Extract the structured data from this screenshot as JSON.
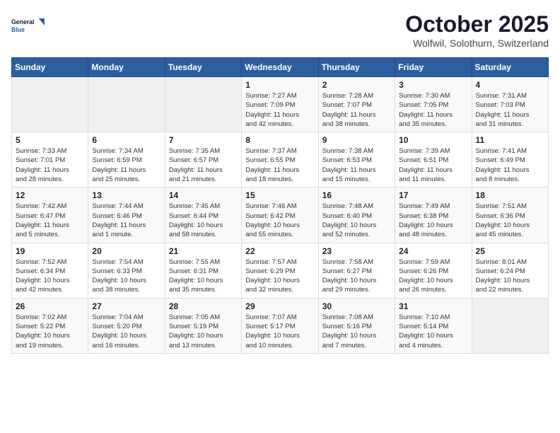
{
  "header": {
    "logo_line1": "General",
    "logo_line2": "Blue",
    "month_title": "October 2025",
    "location": "Wolfwil, Solothurn, Switzerland"
  },
  "weekdays": [
    "Sunday",
    "Monday",
    "Tuesday",
    "Wednesday",
    "Thursday",
    "Friday",
    "Saturday"
  ],
  "weeks": [
    [
      {
        "day": "",
        "info": ""
      },
      {
        "day": "",
        "info": ""
      },
      {
        "day": "",
        "info": ""
      },
      {
        "day": "1",
        "info": "Sunrise: 7:27 AM\nSunset: 7:09 PM\nDaylight: 11 hours\nand 42 minutes."
      },
      {
        "day": "2",
        "info": "Sunrise: 7:28 AM\nSunset: 7:07 PM\nDaylight: 11 hours\nand 38 minutes."
      },
      {
        "day": "3",
        "info": "Sunrise: 7:30 AM\nSunset: 7:05 PM\nDaylight: 11 hours\nand 35 minutes."
      },
      {
        "day": "4",
        "info": "Sunrise: 7:31 AM\nSunset: 7:03 PM\nDaylight: 11 hours\nand 31 minutes."
      }
    ],
    [
      {
        "day": "5",
        "info": "Sunrise: 7:33 AM\nSunset: 7:01 PM\nDaylight: 11 hours\nand 28 minutes."
      },
      {
        "day": "6",
        "info": "Sunrise: 7:34 AM\nSunset: 6:59 PM\nDaylight: 11 hours\nand 25 minutes."
      },
      {
        "day": "7",
        "info": "Sunrise: 7:35 AM\nSunset: 6:57 PM\nDaylight: 11 hours\nand 21 minutes."
      },
      {
        "day": "8",
        "info": "Sunrise: 7:37 AM\nSunset: 6:55 PM\nDaylight: 11 hours\nand 18 minutes."
      },
      {
        "day": "9",
        "info": "Sunrise: 7:38 AM\nSunset: 6:53 PM\nDaylight: 11 hours\nand 15 minutes."
      },
      {
        "day": "10",
        "info": "Sunrise: 7:39 AM\nSunset: 6:51 PM\nDaylight: 11 hours\nand 11 minutes."
      },
      {
        "day": "11",
        "info": "Sunrise: 7:41 AM\nSunset: 6:49 PM\nDaylight: 11 hours\nand 8 minutes."
      }
    ],
    [
      {
        "day": "12",
        "info": "Sunrise: 7:42 AM\nSunset: 6:47 PM\nDaylight: 11 hours\nand 5 minutes."
      },
      {
        "day": "13",
        "info": "Sunrise: 7:44 AM\nSunset: 6:46 PM\nDaylight: 11 hours\nand 1 minute."
      },
      {
        "day": "14",
        "info": "Sunrise: 7:45 AM\nSunset: 6:44 PM\nDaylight: 10 hours\nand 58 minutes."
      },
      {
        "day": "15",
        "info": "Sunrise: 7:46 AM\nSunset: 6:42 PM\nDaylight: 10 hours\nand 55 minutes."
      },
      {
        "day": "16",
        "info": "Sunrise: 7:48 AM\nSunset: 6:40 PM\nDaylight: 10 hours\nand 52 minutes."
      },
      {
        "day": "17",
        "info": "Sunrise: 7:49 AM\nSunset: 6:38 PM\nDaylight: 10 hours\nand 48 minutes."
      },
      {
        "day": "18",
        "info": "Sunrise: 7:51 AM\nSunset: 6:36 PM\nDaylight: 10 hours\nand 45 minutes."
      }
    ],
    [
      {
        "day": "19",
        "info": "Sunrise: 7:52 AM\nSunset: 6:34 PM\nDaylight: 10 hours\nand 42 minutes."
      },
      {
        "day": "20",
        "info": "Sunrise: 7:54 AM\nSunset: 6:33 PM\nDaylight: 10 hours\nand 38 minutes."
      },
      {
        "day": "21",
        "info": "Sunrise: 7:55 AM\nSunset: 6:31 PM\nDaylight: 10 hours\nand 35 minutes."
      },
      {
        "day": "22",
        "info": "Sunrise: 7:57 AM\nSunset: 6:29 PM\nDaylight: 10 hours\nand 32 minutes."
      },
      {
        "day": "23",
        "info": "Sunrise: 7:58 AM\nSunset: 6:27 PM\nDaylight: 10 hours\nand 29 minutes."
      },
      {
        "day": "24",
        "info": "Sunrise: 7:59 AM\nSunset: 6:26 PM\nDaylight: 10 hours\nand 26 minutes."
      },
      {
        "day": "25",
        "info": "Sunrise: 8:01 AM\nSunset: 6:24 PM\nDaylight: 10 hours\nand 22 minutes."
      }
    ],
    [
      {
        "day": "26",
        "info": "Sunrise: 7:02 AM\nSunset: 5:22 PM\nDaylight: 10 hours\nand 19 minutes."
      },
      {
        "day": "27",
        "info": "Sunrise: 7:04 AM\nSunset: 5:20 PM\nDaylight: 10 hours\nand 16 minutes."
      },
      {
        "day": "28",
        "info": "Sunrise: 7:05 AM\nSunset: 5:19 PM\nDaylight: 10 hours\nand 13 minutes."
      },
      {
        "day": "29",
        "info": "Sunrise: 7:07 AM\nSunset: 5:17 PM\nDaylight: 10 hours\nand 10 minutes."
      },
      {
        "day": "30",
        "info": "Sunrise: 7:08 AM\nSunset: 5:16 PM\nDaylight: 10 hours\nand 7 minutes."
      },
      {
        "day": "31",
        "info": "Sunrise: 7:10 AM\nSunset: 5:14 PM\nDaylight: 10 hours\nand 4 minutes."
      },
      {
        "day": "",
        "info": ""
      }
    ]
  ]
}
